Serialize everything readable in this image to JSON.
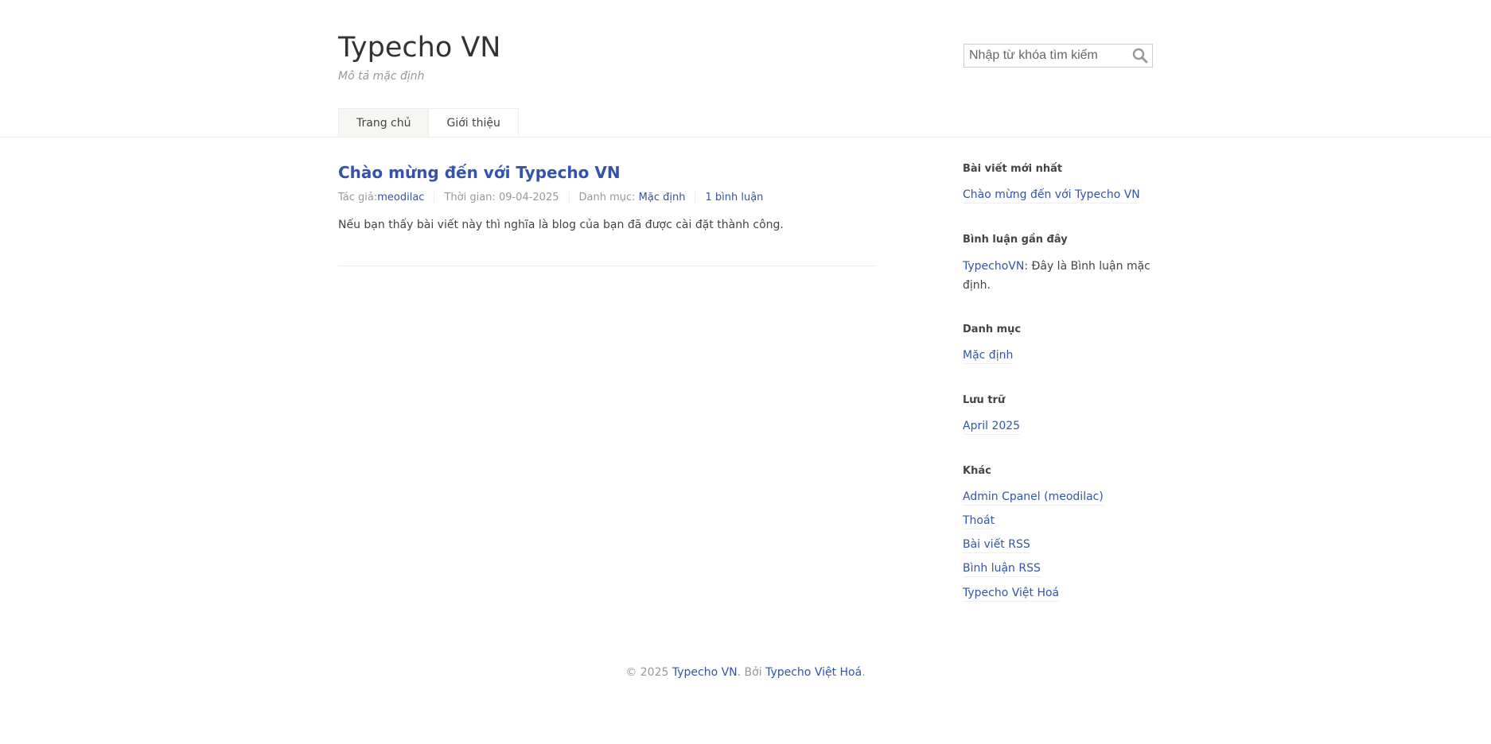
{
  "site": {
    "title": "Typecho VN",
    "description": "Mô tả mặc định"
  },
  "search": {
    "placeholder": "Nhập từ khóa tìm kiếm",
    "icon": "search-icon"
  },
  "nav": {
    "items": [
      {
        "label": "Trang chủ",
        "active": true
      },
      {
        "label": "Giới thiệu",
        "active": false
      }
    ]
  },
  "post": {
    "title": "Chào mừng đến với Typecho VN",
    "author_label": "Tác giả:",
    "author": "meodilac",
    "time_label": "Thời gian: ",
    "time": "09-04-2025",
    "category_label": "Danh mục: ",
    "category": "Mặc định",
    "comments": "1 bình luận",
    "body": "Nếu bạn thấy bài viết này thì nghĩa là blog của bạn đã được cài đặt thành công."
  },
  "sidebar": {
    "recent_posts": {
      "title": "Bài viết mới nhất",
      "items": [
        "Chào mừng đến với Typecho VN"
      ]
    },
    "recent_comments": {
      "title": "Bình luận gần đây",
      "author": "TypechoVN",
      "text": ": Đây là Bình luận mặc định."
    },
    "categories": {
      "title": "Danh mục",
      "items": [
        "Mặc định"
      ]
    },
    "archives": {
      "title": "Lưu trữ",
      "items": [
        "April 2025"
      ]
    },
    "other": {
      "title": "Khác",
      "items": [
        "Admin Cpanel (meodilac)",
        "Thoát",
        "Bài viết RSS",
        "Bình luận RSS",
        "Typecho Việt Hoá"
      ]
    }
  },
  "footer": {
    "copyright": "© 2025 ",
    "site_link": "Typecho VN",
    "by_text": ". Bởi ",
    "powered_link": "Typecho Việt Hoá",
    "end": "."
  },
  "colors": {
    "link": "#3354AA",
    "text": "#444444",
    "muted": "#999999"
  }
}
